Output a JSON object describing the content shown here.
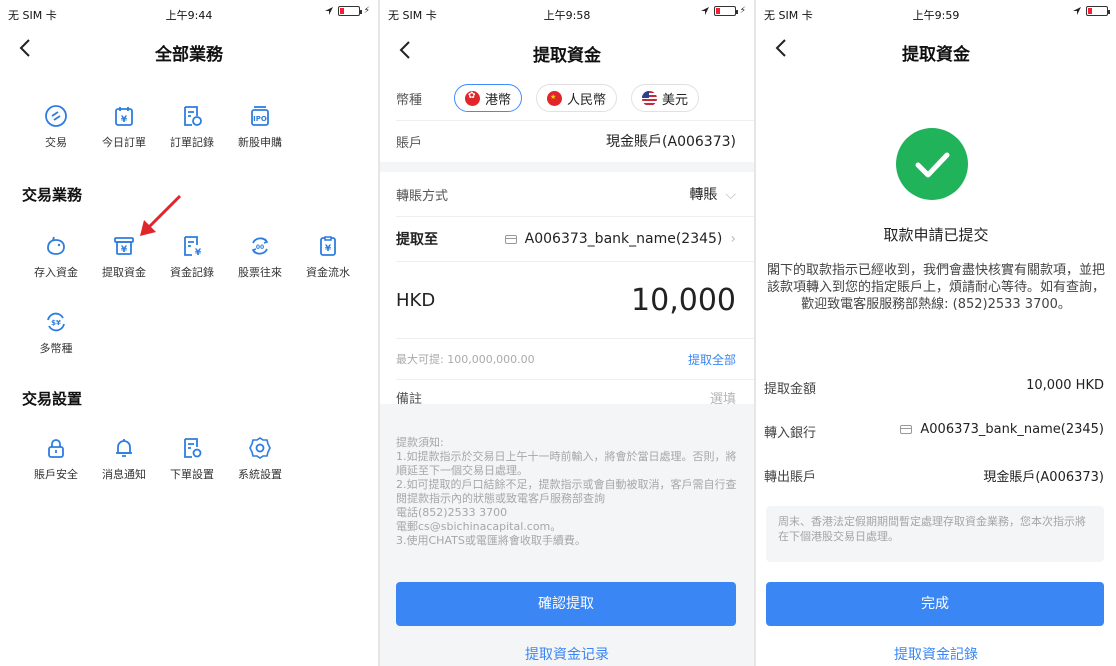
{
  "status_bars": [
    {
      "carrier": "无 SIM 卡",
      "time": "上午9:44"
    },
    {
      "carrier": "无 SIM 卡",
      "time": "上午9:58"
    },
    {
      "carrier": "无 SIM 卡",
      "time": "上午9:59"
    }
  ],
  "screen1": {
    "title": "全部業務",
    "top_items": [
      {
        "label": "交易",
        "icon": "trade-icon"
      },
      {
        "label": "今日訂單",
        "icon": "today-order-icon"
      },
      {
        "label": "訂單記錄",
        "icon": "order-record-icon"
      },
      {
        "label": "新股申購",
        "icon": "ipo-icon"
      }
    ],
    "section_trading": "交易業務",
    "trading_items": [
      {
        "label": "存入資金",
        "icon": "deposit-icon"
      },
      {
        "label": "提取資金",
        "icon": "withdraw-icon"
      },
      {
        "label": "資金記錄",
        "icon": "fund-record-icon"
      },
      {
        "label": "股票往來",
        "icon": "stock-transfer-icon"
      },
      {
        "label": "資金流水",
        "icon": "fund-flow-icon"
      }
    ],
    "trading_items_row2": [
      {
        "label": "多幣種",
        "icon": "multi-currency-icon"
      }
    ],
    "section_settings": "交易設置",
    "settings_items": [
      {
        "label": "賬戶安全",
        "icon": "lock-icon"
      },
      {
        "label": "消息通知",
        "icon": "bell-icon"
      },
      {
        "label": "下單設置",
        "icon": "order-settings-icon"
      },
      {
        "label": "系統設置",
        "icon": "gear-icon"
      }
    ],
    "ipo_text": "IPO",
    "yen_text": "¥",
    "multi_text": "$¥"
  },
  "screen2": {
    "title": "提取資金",
    "currency_label": "幣種",
    "currencies": [
      {
        "label": "港幣",
        "flag": "hk",
        "selected": true
      },
      {
        "label": "人民幣",
        "flag": "cn",
        "selected": false
      },
      {
        "label": "美元",
        "flag": "us",
        "selected": false
      }
    ],
    "account_label": "賬戶",
    "account_value": "現金賬戶(A006373)",
    "transfer_method_label": "轉賬方式",
    "transfer_method_value": "轉賬",
    "withdraw_to_label": "提取至",
    "withdraw_to_value": "A006373_bank_name(2345)",
    "currency_code": "HKD",
    "amount": "10,000",
    "max_withdraw": "最大可提: 100,000,000.00",
    "withdraw_all": "提取全部",
    "remark_label": "備註",
    "remark_placeholder": "選填",
    "notes": [
      "提款須知:",
      "1.如提款指示於交易日上午十一時前輸入，將會於當日處理。否則，將順延至下一個交易日處理。",
      "2.如可提取的戶口結餘不足，提款指示或會自動被取消，客戶需自行查閱提款指示內的狀態或致電客戶服務部查詢",
      "電話(852)2533 3700",
      "電郵cs@sbichinacapital.com。",
      "3.使用CHATS或電匯將會收取手續費。"
    ],
    "confirm_button": "確認提取",
    "history_link": "提取資金记录"
  },
  "screen3": {
    "title": "提取資金",
    "success_title": "取款申請已提交",
    "success_desc": "閣下的取款指示已經收到，我們會盡快核實有關款項，並把該款項轉入到您的指定賬戶上，煩請耐心等待。如有查詢，歡迎致電客服服務部熱線: (852)2533 3700。",
    "amount_label": "提取金額",
    "amount_value": "10,000 HKD",
    "bank_label": "轉入銀行",
    "bank_value": "A006373_bank_name(2345)",
    "account_label": "轉出賬戶",
    "account_value": "現金賬戶(A006373)",
    "notice": "周末、香港法定假期期間暫定處理存取資金業務，您本次指示將在下個港股交易日處理。",
    "done_button": "完成",
    "history_link": "提取資金記錄"
  },
  "colors": {
    "accent": "#3a86f5",
    "success": "#20b35a",
    "red": "#e0262b"
  }
}
